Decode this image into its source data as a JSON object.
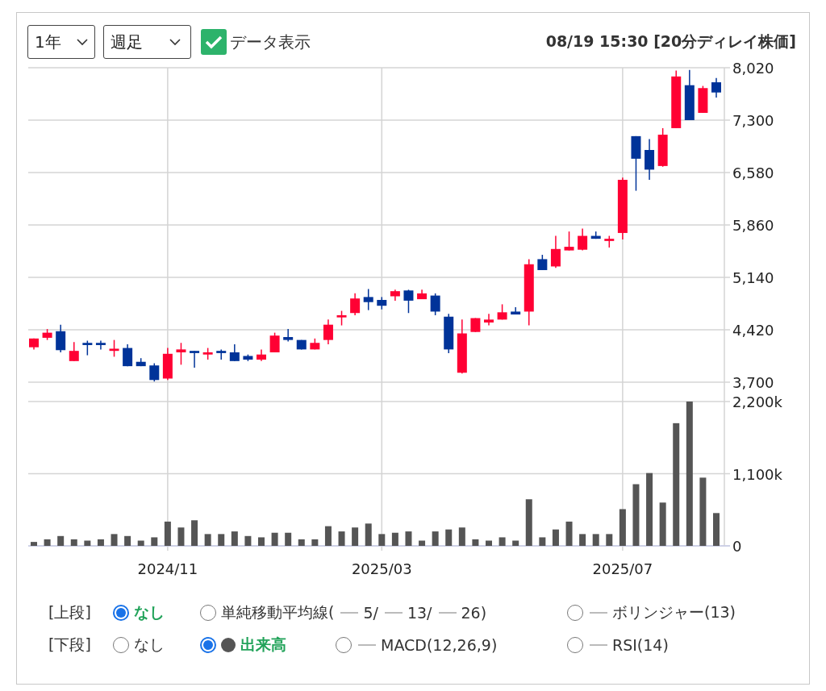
{
  "controls": {
    "period": {
      "value": "1年"
    },
    "interval": {
      "value": "週足"
    },
    "show_data": {
      "label": "データ表示",
      "checked": true
    },
    "timestamp": "08/19 15:30 [20分ディレイ株価]"
  },
  "price_chart": {
    "chart_data": {
      "type": "candlestick",
      "grid": true,
      "categories": [
        null,
        null,
        null,
        null,
        null,
        null,
        null,
        null,
        null,
        null,
        null,
        null,
        null,
        null,
        null,
        null,
        null,
        null,
        null,
        null,
        null,
        null,
        null,
        null,
        null,
        null,
        null,
        null,
        null,
        null,
        null,
        null,
        null,
        null,
        null,
        null,
        null,
        null,
        null,
        null,
        null,
        null,
        null,
        null,
        null,
        null,
        null,
        null,
        null,
        null,
        null,
        null
      ],
      "ylim": [
        3700,
        8020
      ],
      "yticks": [
        {
          "value": 3700,
          "label": "3,700"
        },
        {
          "value": 4420,
          "label": "4,420"
        },
        {
          "value": 5140,
          "label": "5,140"
        },
        {
          "value": 5860,
          "label": "5,860"
        },
        {
          "value": 6580,
          "label": "6,580"
        },
        {
          "value": 7300,
          "label": "7,300"
        },
        {
          "value": 8020,
          "label": "8,020"
        }
      ],
      "ohlc": [
        [
          4180,
          4300,
          4150,
          4300
        ],
        [
          4310,
          4430,
          4280,
          4380
        ],
        [
          4400,
          4490,
          4110,
          4140
        ],
        [
          3990,
          4250,
          3990,
          4130
        ],
        [
          4240,
          4270,
          4070,
          4210
        ],
        [
          4240,
          4270,
          4150,
          4210
        ],
        [
          4130,
          4280,
          4050,
          4160
        ],
        [
          4170,
          4220,
          3920,
          3920
        ],
        [
          3980,
          4030,
          3920,
          3920
        ],
        [
          3930,
          3960,
          3710,
          3730
        ],
        [
          3750,
          4170,
          3730,
          4090
        ],
        [
          4110,
          4240,
          3940,
          4150
        ],
        [
          4130,
          4130,
          3900,
          4100
        ],
        [
          4080,
          4170,
          4010,
          4110
        ],
        [
          4130,
          4150,
          4010,
          4100
        ],
        [
          4110,
          4220,
          3990,
          3990
        ],
        [
          4060,
          4080,
          3990,
          4010
        ],
        [
          4010,
          4150,
          3990,
          4080
        ],
        [
          4110,
          4380,
          4110,
          4340
        ],
        [
          4320,
          4430,
          4260,
          4280
        ],
        [
          4280,
          4280,
          4150,
          4150
        ],
        [
          4150,
          4300,
          4150,
          4240
        ],
        [
          4280,
          4560,
          4220,
          4490
        ],
        [
          4590,
          4680,
          4480,
          4620
        ],
        [
          4650,
          4920,
          4620,
          4850
        ],
        [
          4870,
          4980,
          4690,
          4800
        ],
        [
          4830,
          4870,
          4700,
          4750
        ],
        [
          4880,
          4970,
          4820,
          4950
        ],
        [
          4960,
          4970,
          4650,
          4820
        ],
        [
          4840,
          4970,
          4840,
          4920
        ],
        [
          4890,
          4920,
          4620,
          4670
        ],
        [
          4600,
          4640,
          4100,
          4150
        ],
        [
          3830,
          4560,
          3820,
          4370
        ],
        [
          4390,
          4580,
          4390,
          4580
        ],
        [
          4520,
          4640,
          4480,
          4560
        ],
        [
          4560,
          4770,
          4560,
          4660
        ],
        [
          4670,
          4730,
          4630,
          4630
        ],
        [
          4670,
          5390,
          4480,
          5320
        ],
        [
          5390,
          5450,
          5240,
          5240
        ],
        [
          5290,
          5710,
          5270,
          5530
        ],
        [
          5510,
          5770,
          5510,
          5560
        ],
        [
          5520,
          5810,
          5510,
          5710
        ],
        [
          5710,
          5770,
          5670,
          5670
        ],
        [
          5640,
          5710,
          5550,
          5670
        ],
        [
          5750,
          6510,
          5660,
          6480
        ],
        [
          7080,
          7080,
          6330,
          6770
        ],
        [
          6890,
          7040,
          6480,
          6620
        ],
        [
          6670,
          7190,
          6660,
          7100
        ],
        [
          7190,
          7980,
          7190,
          7900
        ],
        [
          7780,
          7990,
          7300,
          7300
        ],
        [
          7400,
          7770,
          7400,
          7740
        ],
        [
          7820,
          7880,
          7610,
          7680
        ]
      ]
    }
  },
  "volume_chart": {
    "chart_data": {
      "type": "bar",
      "grid": true,
      "categories": [
        null,
        null,
        null,
        null,
        null,
        null,
        null,
        null,
        null,
        null,
        "2024/11",
        null,
        null,
        null,
        null,
        null,
        null,
        null,
        null,
        null,
        null,
        null,
        null,
        null,
        null,
        null,
        "2025/03",
        null,
        null,
        null,
        null,
        null,
        null,
        null,
        null,
        null,
        null,
        null,
        null,
        null,
        null,
        null,
        null,
        null,
        "2025/07",
        null,
        null,
        null,
        null,
        null,
        null,
        null
      ],
      "ylim": [
        0,
        2200
      ],
      "yticks": [
        {
          "value": 0,
          "label": "0"
        },
        {
          "value": 1100,
          "label": "1,100k"
        },
        {
          "value": 2200,
          "label": "2,200k"
        }
      ],
      "series": [
        {
          "color": "#555555",
          "values": [
            60,
            100,
            150,
            100,
            80,
            100,
            180,
            150,
            80,
            130,
            370,
            280,
            390,
            180,
            180,
            220,
            150,
            130,
            200,
            200,
            100,
            100,
            300,
            220,
            280,
            340,
            180,
            200,
            220,
            80,
            220,
            250,
            280,
            100,
            80,
            130,
            80,
            710,
            130,
            250,
            370,
            180,
            180,
            180,
            560,
            940,
            1110,
            660,
            1870,
            2200,
            1040,
            500
          ]
        }
      ]
    }
  },
  "legend": [
    {
      "label": "[上段]",
      "options": [
        {
          "selected": true,
          "segments": [
            {
              "kind": "text",
              "text": "なし"
            }
          ]
        },
        {
          "selected": false,
          "segments": [
            {
              "kind": "text",
              "text": "単純移動平均線("
            },
            {
              "kind": "line",
              "text": "5/"
            },
            {
              "kind": "line",
              "text": "13/"
            },
            {
              "kind": "line",
              "text": "26)"
            }
          ]
        },
        {
          "selected": false,
          "segments": [
            {
              "kind": "line",
              "text": "ボリンジャー(13)"
            }
          ]
        }
      ]
    },
    {
      "label": "[下段]",
      "options": [
        {
          "selected": false,
          "segments": [
            {
              "kind": "text",
              "text": "なし"
            }
          ]
        },
        {
          "selected": true,
          "segments": [
            {
              "kind": "dot",
              "text": "出来高"
            }
          ]
        },
        {
          "selected": false,
          "segments": [
            {
              "kind": "line",
              "text": "MACD(12,26,9)"
            }
          ]
        },
        {
          "selected": false,
          "segments": [
            {
              "kind": "line",
              "text": "RSI(14)"
            }
          ]
        }
      ]
    }
  ]
}
